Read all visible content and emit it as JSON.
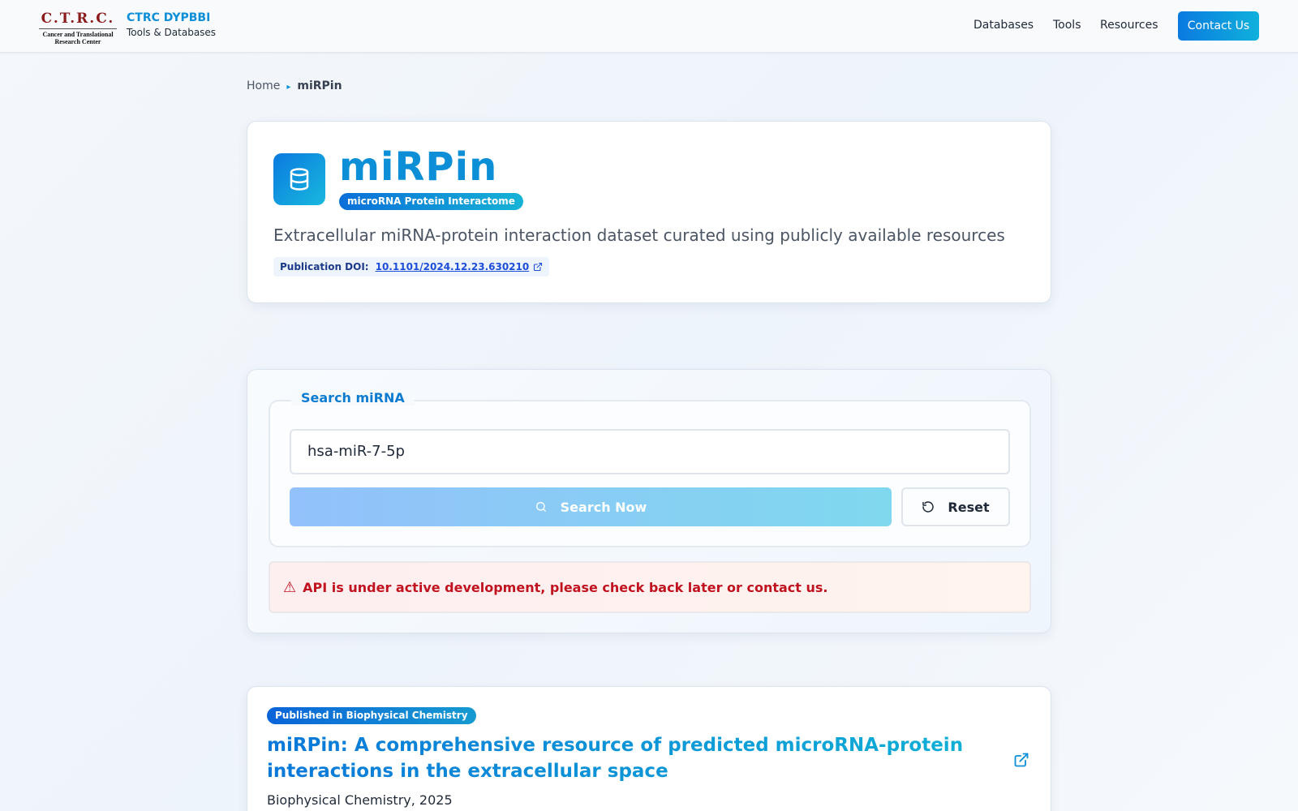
{
  "brand": {
    "logo_main": "C.T.R.C.",
    "logo_sub_line1": "Cancer and Translational",
    "logo_sub_line2": "Research Center",
    "title": "CTRC DYPBBI",
    "subtitle": "Tools & Databases"
  },
  "nav": {
    "items": [
      {
        "label": "Databases"
      },
      {
        "label": "Tools"
      },
      {
        "label": "Resources"
      }
    ],
    "contact_label": "Contact Us"
  },
  "breadcrumb": {
    "home": "Home",
    "separator": "▸",
    "current": "miRPin"
  },
  "header": {
    "icon": "database-icon",
    "title": "miRPin",
    "badge": "microRNA Protein Interactome",
    "description": "Extracellular miRNA-protein interaction dataset curated using publicly available resources",
    "doi_label": "Publication DOI:",
    "doi_value": "10.1101/2024.12.23.630210"
  },
  "search": {
    "legend": "Search miRNA",
    "input_value": "hsa-miR-7-5p",
    "search_button_label": "Search Now",
    "reset_button_label": "Reset",
    "alert_icon": "⚠",
    "alert_text": "API is under active development, please check back later or contact us."
  },
  "publication": {
    "badge": "Published in Biophysical Chemistry",
    "title": "miRPin: A comprehensive resource of predicted microRNA-protein interactions in the extracellular space",
    "journal": "Biophysical Chemistry, 2025"
  },
  "colors": {
    "brand_blue": "#0d8fd8",
    "alert_red": "#c1121f",
    "logo_red": "#8b1a1a"
  }
}
